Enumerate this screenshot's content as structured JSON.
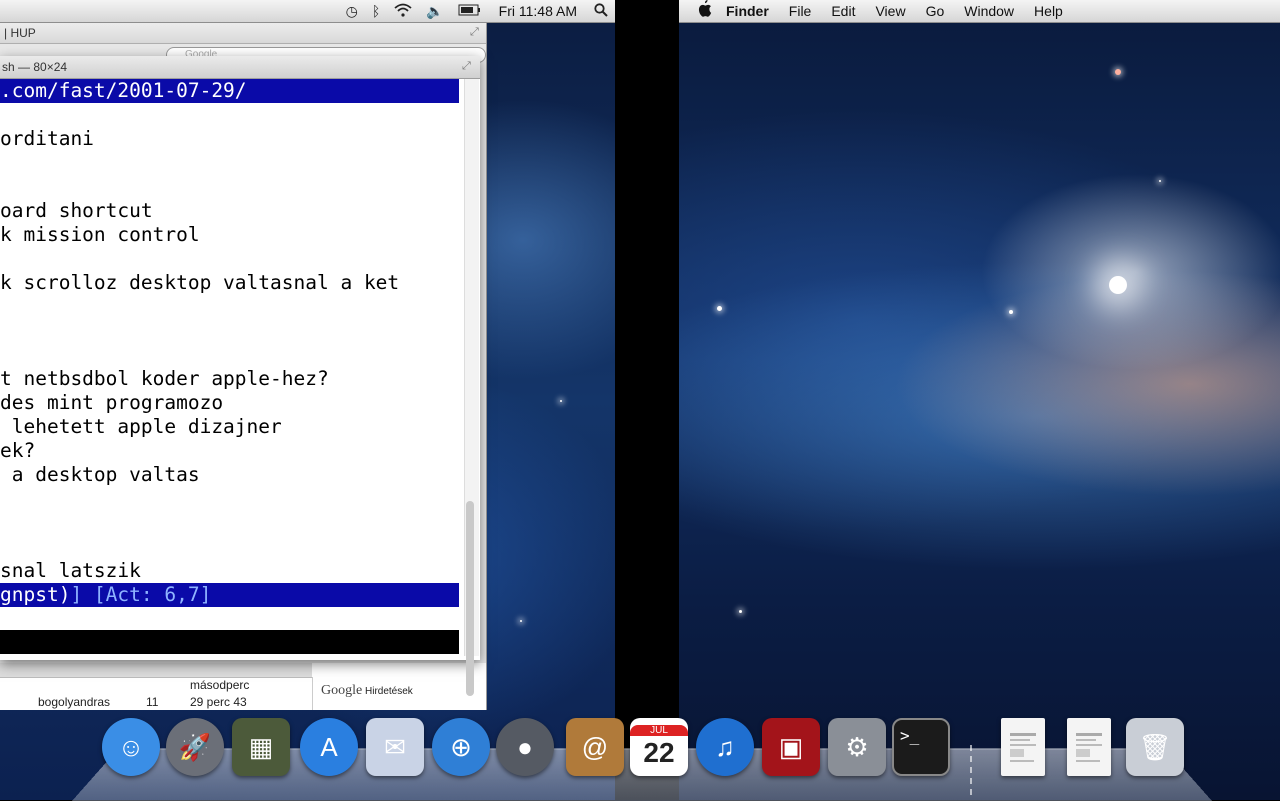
{
  "menubar_left": {
    "clock": "Fri 11:48 AM",
    "icons": [
      "time-machine-icon",
      "bluetooth-icon",
      "wifi-icon",
      "volume-icon",
      "battery-icon",
      "spotlight-icon"
    ]
  },
  "menubar_right": {
    "app": "Finder",
    "items": [
      "File",
      "Edit",
      "View",
      "Go",
      "Window",
      "Help"
    ]
  },
  "browser": {
    "title": "| HUP",
    "search_placeholder": "Google",
    "row_user": "bogolyandras",
    "row_num": "11",
    "row_time1": "másodperc",
    "row_time2": "29 perc 43",
    "ad_brand": "Google",
    "ad_label": "Hirdetések"
  },
  "terminal": {
    "title": "sh — 80×24",
    "lines": [
      {
        "text": ".com/fast/2001-07-29/",
        "highlight": true
      },
      {
        "text": "",
        "highlight": false
      },
      {
        "text": "orditani",
        "highlight": false
      },
      {
        "text": "",
        "highlight": false
      },
      {
        "text": "",
        "highlight": false
      },
      {
        "text": "oard shortcut",
        "highlight": false
      },
      {
        "text": "k mission control",
        "highlight": false
      },
      {
        "text": "",
        "highlight": false
      },
      {
        "text": "k scrolloz desktop valtasnal a ket",
        "highlight": false
      },
      {
        "text": "",
        "highlight": false
      },
      {
        "text": "",
        "highlight": false
      },
      {
        "text": "",
        "highlight": false
      },
      {
        "text": "t netbsdbol koder apple-hez?",
        "highlight": false
      },
      {
        "text": "des mint programozo",
        "highlight": false
      },
      {
        "text": " lehetett apple dizajner",
        "highlight": false
      },
      {
        "text": "ek?",
        "highlight": false
      },
      {
        "text": " a desktop valtas",
        "highlight": false
      },
      {
        "text": "",
        "highlight": false
      },
      {
        "text": "",
        "highlight": false
      },
      {
        "text": "",
        "highlight": false
      },
      {
        "text": "snal latszik",
        "highlight": false
      }
    ],
    "status_prefix": "gnpst)",
    "status_act": "] [Act: 6,7]"
  },
  "dock": {
    "items": [
      {
        "name": "finder",
        "color": "#3a8ee6",
        "glyph": "☺"
      },
      {
        "name": "launchpad",
        "color": "#6b6f78",
        "glyph": "🚀"
      },
      {
        "name": "iphoto",
        "color": "#4c5a3a",
        "glyph": "▦"
      },
      {
        "name": "app-store",
        "color": "#2a7fe0",
        "glyph": "A"
      },
      {
        "name": "mail",
        "color": "#c9d3e6",
        "glyph": "✉"
      },
      {
        "name": "safari",
        "color": "#2f7fd6",
        "glyph": "⊕"
      },
      {
        "name": "facetime",
        "color": "#555a63",
        "glyph": "●"
      },
      {
        "name": "address-book",
        "color": "#b07a3a",
        "glyph": "@"
      },
      {
        "name": "calendar",
        "color": "#ffffff",
        "glyph": ""
      },
      {
        "name": "itunes",
        "color": "#1f6fd0",
        "glyph": "♫"
      },
      {
        "name": "photo-booth",
        "color": "#a3141a",
        "glyph": "▣"
      },
      {
        "name": "system-preferences",
        "color": "#8a8f97",
        "glyph": "⚙"
      },
      {
        "name": "terminal",
        "color": "#1b1b1b",
        "glyph": ">_"
      },
      {
        "name": "document-1",
        "color": "#f4f4f4",
        "glyph": ""
      },
      {
        "name": "document-2",
        "color": "#f4f4f4",
        "glyph": ""
      },
      {
        "name": "trash",
        "color": "#c9ced6",
        "glyph": "🗑"
      }
    ],
    "calendar_month": "JUL",
    "calendar_day": "22"
  }
}
